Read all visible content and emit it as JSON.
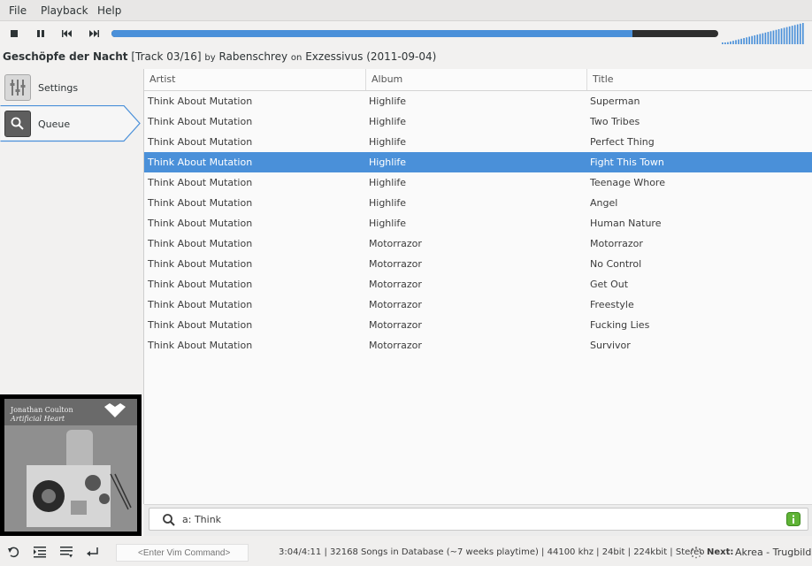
{
  "menu": [
    "File",
    "Playback",
    "Help"
  ],
  "toolbar": {
    "stop_icon": "stop-icon",
    "pause_icon": "pause-icon",
    "prev_icon": "skip-back-icon",
    "next_icon": "skip-forward-icon",
    "progress_fraction": 0.859,
    "volume_fraction": 1.0,
    "colors": {
      "progress_fill": "#4a90d9",
      "progress_track": "#2e2e2e",
      "volume": "#4a90d9"
    }
  },
  "now_playing": {
    "title": "Geschöpfe der Nacht",
    "track": "[Track 03/16]",
    "by_word": "by",
    "artist": "Rabenschrey",
    "on_word": "on",
    "album": "Exzessivus (2011-09-04)"
  },
  "sidebar": {
    "items": [
      {
        "label": "Settings",
        "icon": "sliders-icon"
      },
      {
        "label": "Queue",
        "icon": "search-icon"
      }
    ],
    "active": "Queue"
  },
  "album_art": {
    "artist": "Jonathan Coulton",
    "album": "Artificial Heart"
  },
  "table": {
    "columns": [
      "Artist",
      "Album",
      "Title"
    ],
    "rows": [
      [
        "Think About Mutation",
        "Highlife",
        "Superman"
      ],
      [
        "Think About Mutation",
        "Highlife",
        "Two Tribes"
      ],
      [
        "Think About Mutation",
        "Highlife",
        "Perfect Thing"
      ],
      [
        "Think About Mutation",
        "Highlife",
        "Fight This Town"
      ],
      [
        "Think About Mutation",
        "Highlife",
        "Teenage Whore"
      ],
      [
        "Think About Mutation",
        "Highlife",
        "Angel"
      ],
      [
        "Think About Mutation",
        "Highlife",
        "Human Nature"
      ],
      [
        "Think About Mutation",
        "Motorrazor",
        "Motorrazor"
      ],
      [
        "Think About Mutation",
        "Motorrazor",
        "No Control"
      ],
      [
        "Think About Mutation",
        "Motorrazor",
        "Get Out"
      ],
      [
        "Think About Mutation",
        "Motorrazor",
        "Freestyle"
      ],
      [
        "Think About Mutation",
        "Motorrazor",
        "Fucking Lies"
      ],
      [
        "Think About Mutation",
        "Motorrazor",
        "Survivor"
      ]
    ],
    "selected_index": 3,
    "colors": {
      "selection": "#4a90d9"
    }
  },
  "search": {
    "value": "a: Think",
    "icon": "search-icon",
    "action_icon": "info-icon"
  },
  "statusbar": {
    "icons": [
      "undo-icon",
      "indent-icon",
      "list-icon",
      "return-icon",
      "gear-icon"
    ],
    "vim_placeholder": "<Enter Vim Command>",
    "status": "3:04/4:11 | 32168 Songs in Database (~7 weeks playtime) | 44100 khz | 24bit | 224kbit | Stereo",
    "next_label": "Next:",
    "next_track": "Akrea - Trugbild"
  }
}
